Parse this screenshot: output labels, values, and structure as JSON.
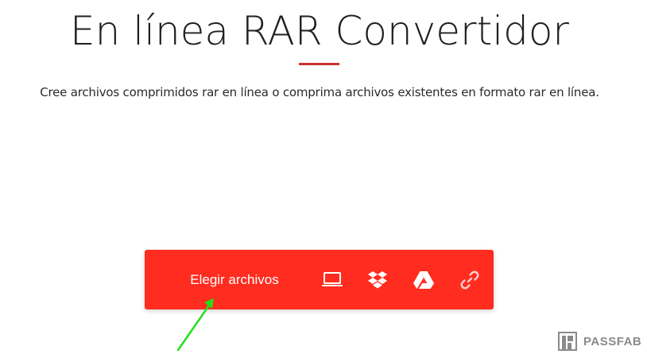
{
  "header": {
    "title": "En línea RAR Convertidor",
    "subtitle": "Cree archivos comprimidos rar en línea o comprima archivos existentes en formato rar en línea."
  },
  "uploader": {
    "choose_label": "Elegir archivos",
    "sources": [
      {
        "icon": "computer-icon"
      },
      {
        "icon": "dropbox-icon"
      },
      {
        "icon": "google-drive-icon"
      },
      {
        "icon": "link-icon"
      }
    ],
    "accent_color": "#ff2c1f"
  },
  "watermark": {
    "text": "PASSFAB"
  },
  "colors": {
    "title_underline": "#c8322e",
    "arrow": "#22e01a"
  }
}
